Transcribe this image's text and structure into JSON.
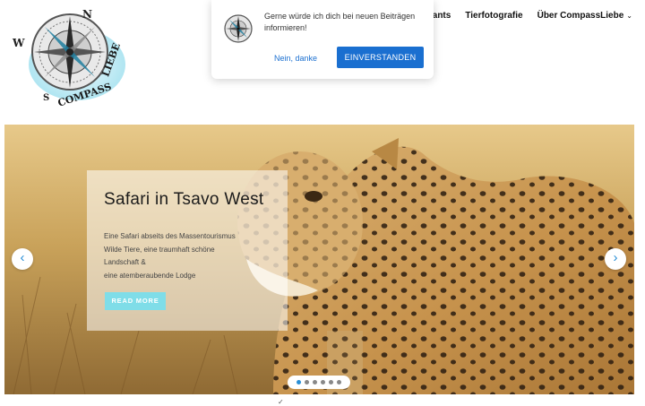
{
  "site": {
    "logo_text": "Compass Liebe"
  },
  "nav": {
    "items": [
      {
        "label": "Restaurants",
        "visible_text": "taurants"
      },
      {
        "label": "Tierfotografie"
      },
      {
        "label": "Über CompassLiebe",
        "has_dropdown": true
      }
    ]
  },
  "popup": {
    "message": "Gerne würde ich dich bei neuen Beiträgen informieren!",
    "decline_label": "Nein, danke",
    "accept_label": "EINVERSTANDEN",
    "accent_color": "#1a6fd0"
  },
  "slider": {
    "title": "Safari in Tsavo West",
    "lines": [
      "Eine Safari abseits des Massentourismus",
      "Wilde Tiere, eine traumhaft schöne",
      "Landschaft &",
      "eine atemberaubende Lodge"
    ],
    "read_more_label": "READ MORE",
    "prev_icon": "chevron-left-icon",
    "next_icon": "chevron-right-icon",
    "dots": 6,
    "active_dot": 1,
    "image_subject": "cheetah"
  }
}
